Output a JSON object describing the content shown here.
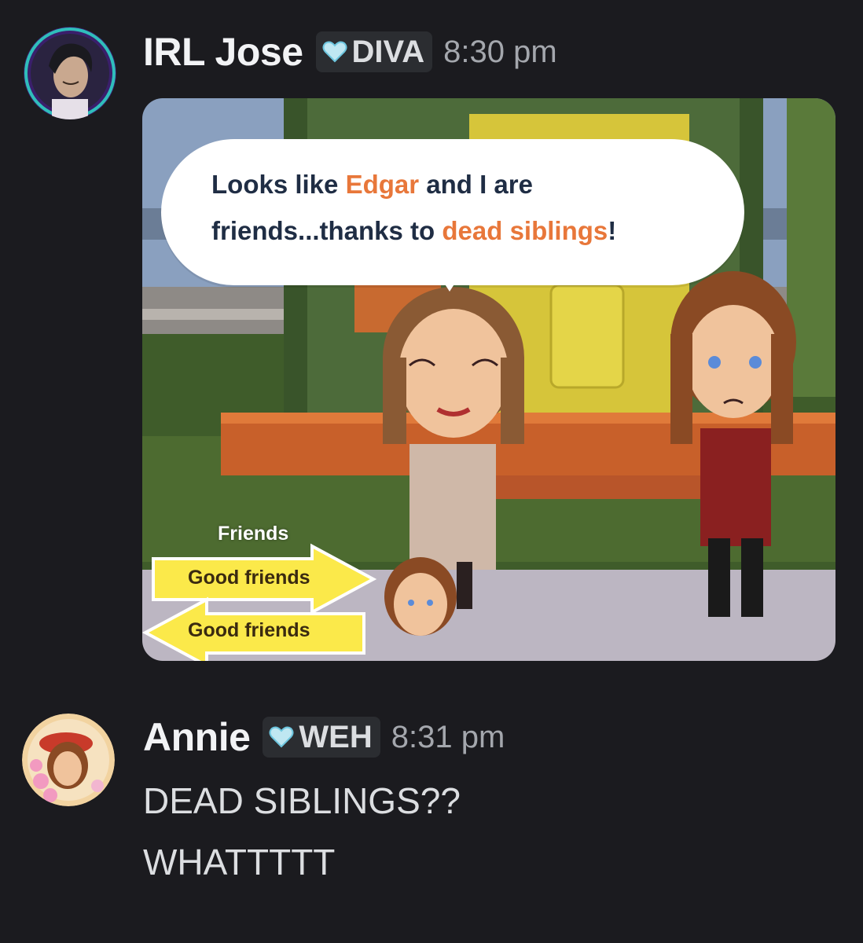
{
  "messages": [
    {
      "username": "IRL Jose",
      "tag": "DIVA",
      "tag_icon": "heart-icon",
      "timestamp": "8:30 pm",
      "attachment": {
        "type": "game-screenshot",
        "speech": {
          "part1": "Looks like ",
          "highlight1": "Edgar",
          "part2": " and I are friends...thanks to ",
          "highlight2": "dead siblings",
          "part3": "!"
        },
        "relationship_title": "Friends",
        "relationship_1": "Good friends",
        "relationship_2": "Good friends"
      }
    },
    {
      "username": "Annie",
      "tag": "WEH",
      "tag_icon": "heart-icon",
      "timestamp": "8:31 pm",
      "lines": [
        "DEAD SIBLINGS??",
        "WHATTTTT"
      ]
    }
  ],
  "colors": {
    "background": "#1b1b1f",
    "highlight": "#e8773a",
    "arrow_fill": "#fbe94a"
  }
}
